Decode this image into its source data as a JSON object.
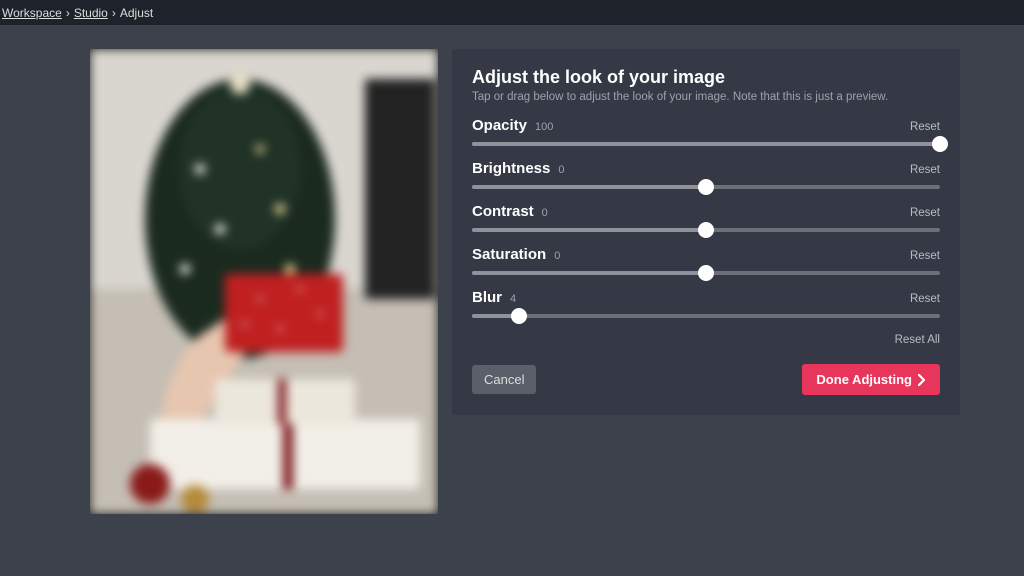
{
  "breadcrumbs": {
    "a": "Workspace",
    "b": "Studio",
    "c": "Adjust",
    "sep": "›"
  },
  "panel": {
    "title": "Adjust the look of your image",
    "subtitle": "Tap or drag below to adjust the look of your image. Note that this is just a preview."
  },
  "sliders": {
    "opacity": {
      "label": "Opacity",
      "value": "100",
      "reset": "Reset",
      "pct": 100
    },
    "brightness": {
      "label": "Brightness",
      "value": "0",
      "reset": "Reset",
      "pct": 50
    },
    "contrast": {
      "label": "Contrast",
      "value": "0",
      "reset": "Reset",
      "pct": 50
    },
    "saturation": {
      "label": "Saturation",
      "value": "0",
      "reset": "Reset",
      "pct": 50
    },
    "blur": {
      "label": "Blur",
      "value": "4",
      "reset": "Reset",
      "pct": 10
    }
  },
  "reset_all": "Reset All",
  "actions": {
    "cancel": "Cancel",
    "done": "Done Adjusting"
  }
}
